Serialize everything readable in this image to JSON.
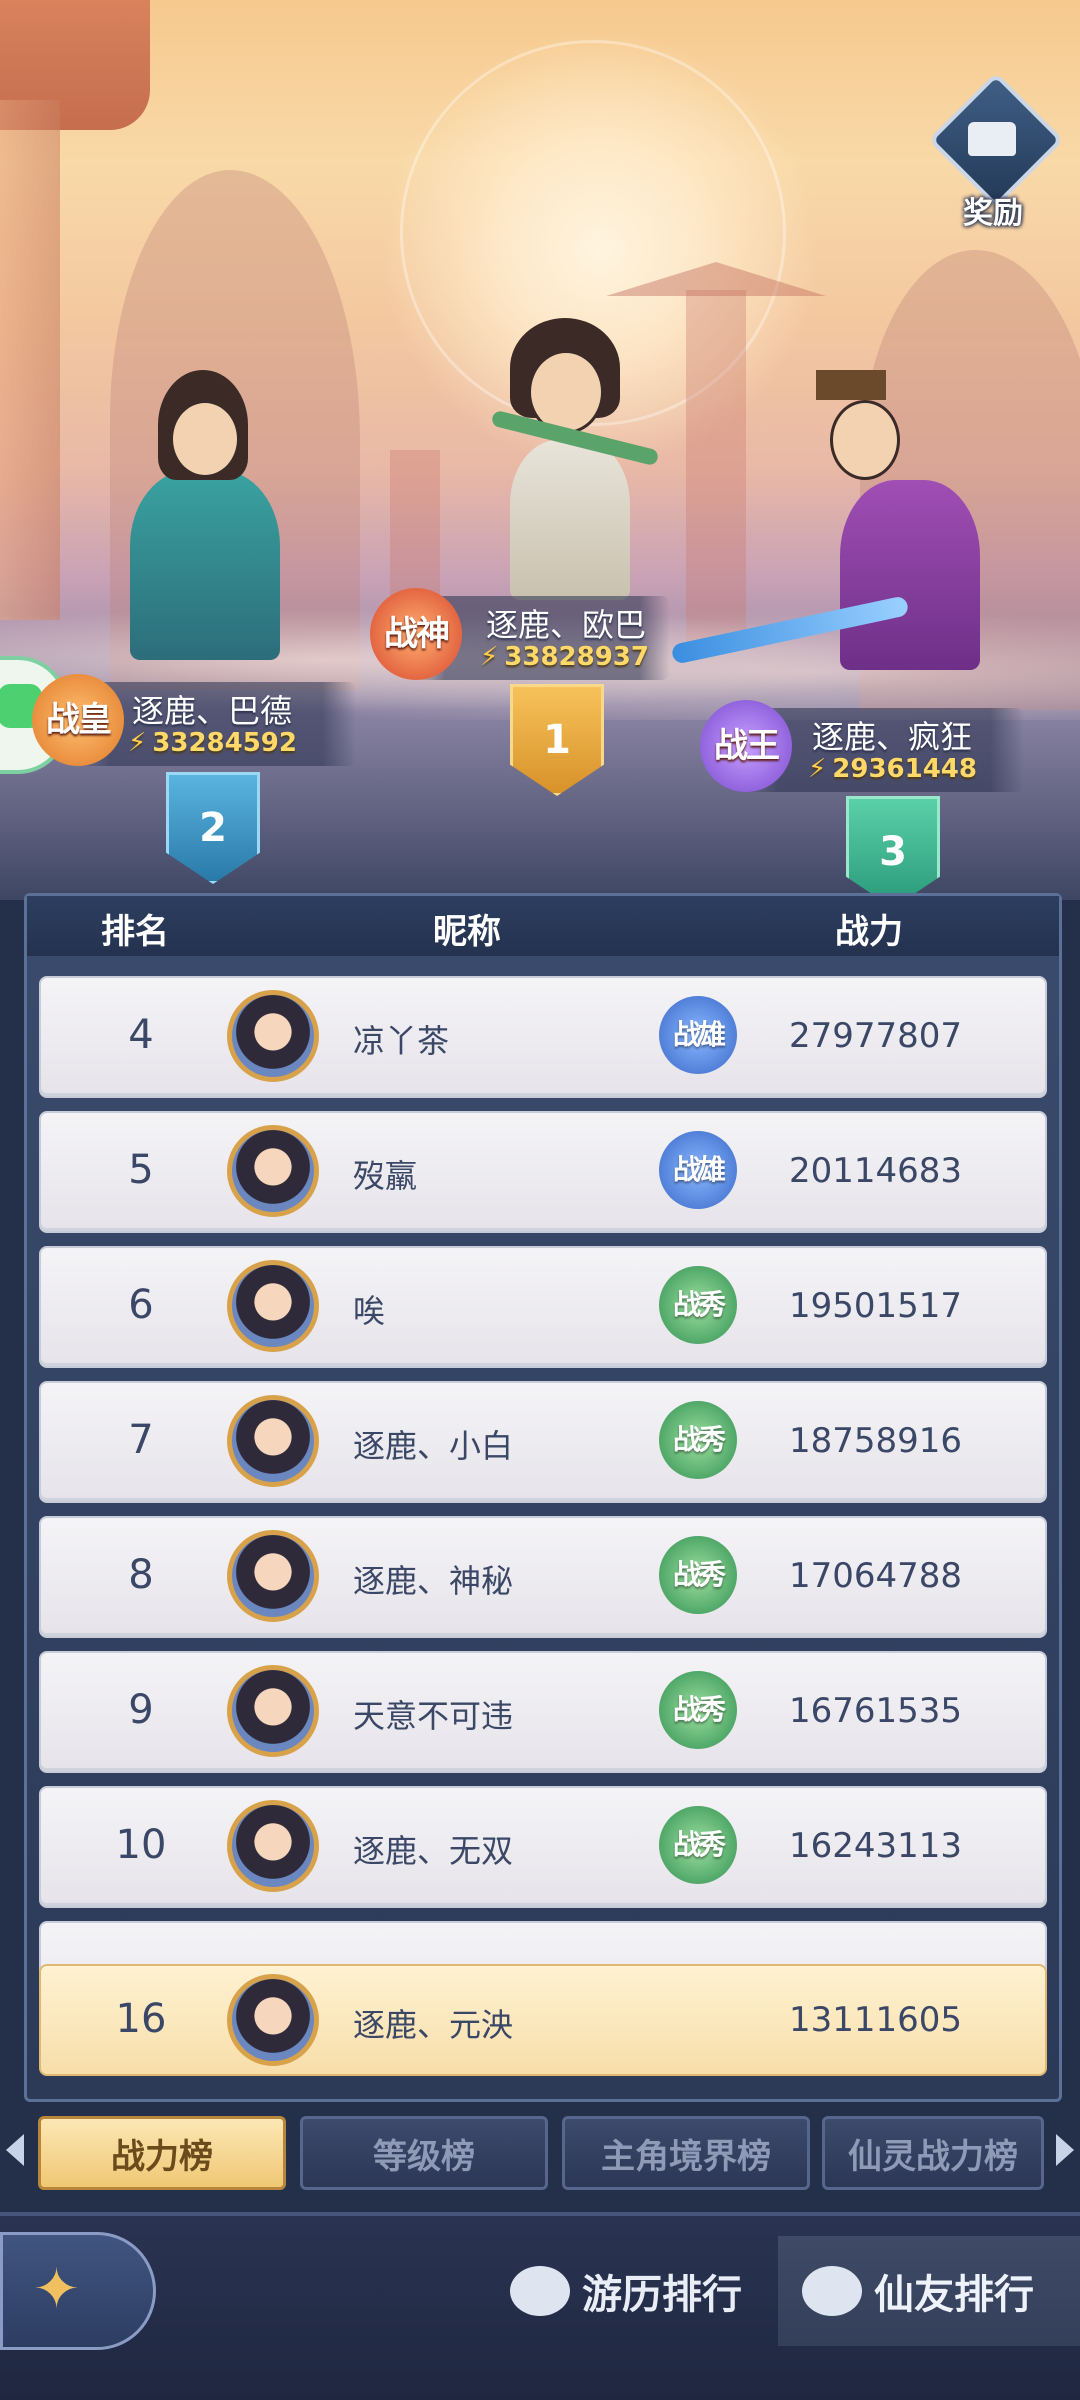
{
  "reward": {
    "label": "奖励"
  },
  "top3": [
    {
      "rank": "1",
      "name": "逐鹿、欧巴",
      "power": "33828937",
      "title": "战神"
    },
    {
      "rank": "2",
      "name": "逐鹿、巴德",
      "power": "33284592",
      "title": "战皇"
    },
    {
      "rank": "3",
      "name": "逐鹿、疯狂",
      "power": "29361448",
      "title": "战王"
    }
  ],
  "table": {
    "headers": {
      "rank": "排名",
      "nickname": "昵称",
      "power": "战力"
    },
    "rows": [
      {
        "rank": "4",
        "name": "凉丫茶",
        "title": "战雄",
        "power": "27977807"
      },
      {
        "rank": "5",
        "name": "歿羸",
        "title": "战雄",
        "power": "20114683"
      },
      {
        "rank": "6",
        "name": "唉",
        "title": "战秀",
        "power": "19501517"
      },
      {
        "rank": "7",
        "name": "逐鹿、小白",
        "title": "战秀",
        "power": "18758916"
      },
      {
        "rank": "8",
        "name": "逐鹿、神秘",
        "title": "战秀",
        "power": "17064788"
      },
      {
        "rank": "9",
        "name": "天意不可违",
        "title": "战秀",
        "power": "16761535"
      },
      {
        "rank": "10",
        "name": "逐鹿、无双",
        "title": "战秀",
        "power": "16243113"
      }
    ],
    "self": {
      "rank": "16",
      "name": "逐鹿、元泱",
      "power": "13111605"
    }
  },
  "tabs": [
    "战力榜",
    "等级榜",
    "主角境界榜",
    "仙灵战力榜"
  ],
  "bottom_nav": {
    "travel_rank": "游历排行",
    "friend_rank": "仙友排行"
  },
  "colors": {
    "gold": "#ffd968",
    "title_blue": "#4a78d8",
    "title_green": "#3aa05a",
    "active_tab": "#f0c874"
  }
}
